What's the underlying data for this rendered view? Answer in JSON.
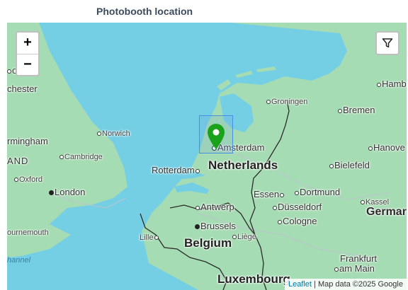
{
  "widget": {
    "title": "Photobooth location"
  },
  "map": {
    "colors": {
      "water": "#75cfe4",
      "land": "#a6dcb3",
      "border": "#2b2b2b",
      "marker": "#1aa31a"
    },
    "zoom_in_label": "+",
    "zoom_out_label": "−",
    "filter_icon": "filter-icon",
    "attribution": {
      "link": "Leaflet",
      "separator": " | ",
      "text": "Map data ©2025 Google"
    },
    "places": {
      "bristol_cut": "ol",
      "manchester_cut": "chester",
      "birmingham_cut": "rmingham",
      "england_cut": "AND",
      "bournemouth_cut": "ournemouth",
      "channel_cut": "hannel",
      "norwich": "Norwich",
      "cambridge": "Cambridge",
      "oxford": "Oxford",
      "london": "London",
      "groningen": "Groningen",
      "bremen": "Bremen",
      "hamburg_cut": "Hamb",
      "hannover_cut": "Hanove",
      "bielefeld": "Bielefeld",
      "amsterdam": "Amsterdam",
      "rotterdam": "Rotterdam",
      "netherlands": "Netherlands",
      "essen": "Essen",
      "dortmund": "Dortmund",
      "kassel": "Kassel",
      "germany_cut": "Germar",
      "antwerp": "Antwerp",
      "dusseldorf": "Düsseldorf",
      "brussels": "Brussels",
      "cologne": "Cologne",
      "lille": "Lille",
      "liege": "Liège",
      "belgium": "Belgium",
      "frankfurt_1": "Frankfurt",
      "frankfurt_2": "am Main",
      "luxembourg_cut": "Luxembourg"
    }
  }
}
